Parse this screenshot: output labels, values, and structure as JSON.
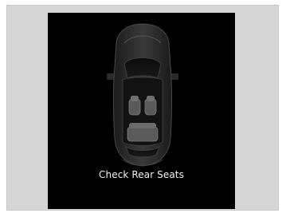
{
  "display": {
    "message": "Check Rear Seats",
    "icons": {
      "car": "car-top-view-icon"
    },
    "colors": {
      "outer_frame": "#d6d6d6",
      "screen_bg": "#000000",
      "text": "#f2f2f2",
      "car_body": "#2a2a2a"
    }
  }
}
